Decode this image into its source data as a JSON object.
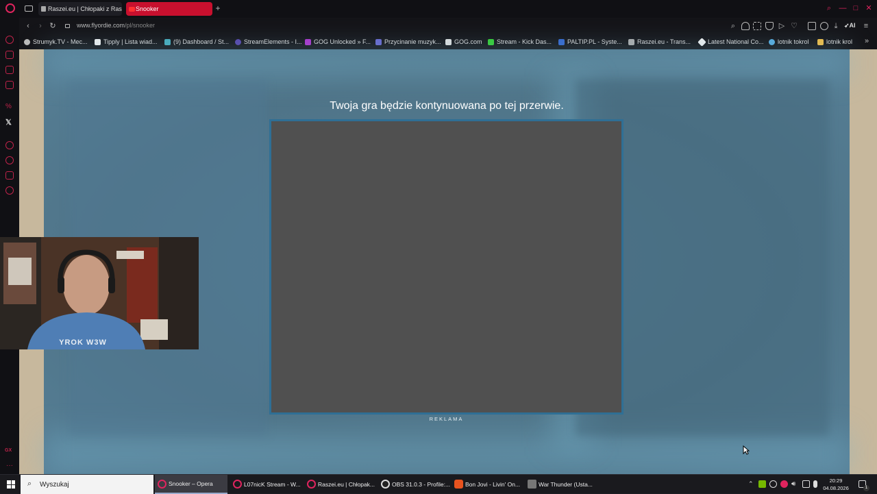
{
  "browser": {
    "tabs": [
      {
        "label": "Raszei.eu | Chłopaki z Ras:",
        "active": false
      },
      {
        "label": "Snooker",
        "active": true
      }
    ],
    "new_tab_symbol": "+",
    "url": {
      "domain": "www.flyordie.com",
      "path": "/pl/snooker"
    }
  },
  "bookmarks": [
    "Strumyk.TV - Mec...",
    "Tipply | Lista wiad...",
    "(9) Dashboard / St...",
    "StreamElements - I...",
    "GOG Unlocked » F...",
    "Przycinanie muzyk...",
    "GOG.com",
    "Stream - Kick Das...",
    "PALTIP.PL - Syste...",
    "Raszei.eu - Trans...",
    "Latest National Co...",
    "lotnik tokrol",
    "lotnik krol"
  ],
  "toolbar": {
    "ai_label": "AI"
  },
  "game": {
    "message": "Twoja gra będzie kontynuowana po tej przerwie.",
    "ad_label": "REKLAMA"
  },
  "webcam": {
    "shirt_text": "YROK W3W"
  },
  "taskbar": {
    "search_placeholder": "Wyszukaj",
    "apps": [
      {
        "label": "Snooker – Opera",
        "active": true
      },
      {
        "label": "L07nicK Stream - W...",
        "active": false
      },
      {
        "label": "Raszei.eu | Chłopak...",
        "active": false
      },
      {
        "label": "OBS 31.0.3 - Profile:...",
        "active": false
      },
      {
        "label": "Bon Jovi - Livin' On...",
        "active": false
      },
      {
        "label": "War Thunder (Usta...",
        "active": false
      }
    ],
    "time": "20:29",
    "date": "04.08.2026",
    "notification_count": "1"
  },
  "colors": {
    "opera_red": "#e0245e",
    "game_bg": "#4f7488",
    "ad_border": "#2f6f95",
    "ad_fill": "#505050"
  }
}
